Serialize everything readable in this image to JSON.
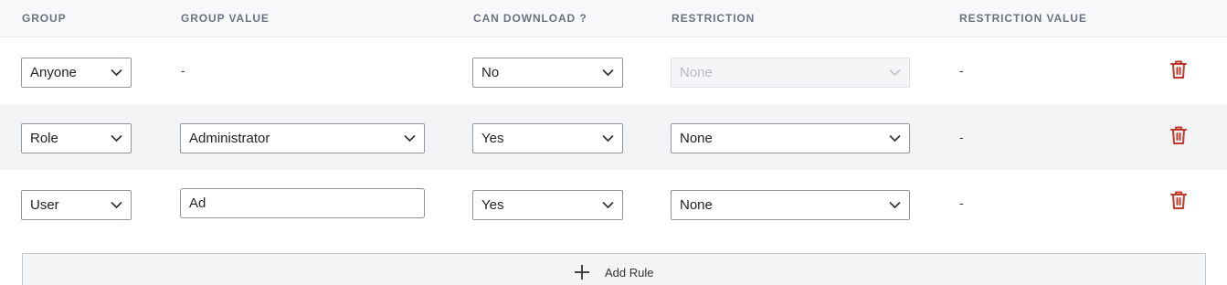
{
  "columns": {
    "group": "GROUP",
    "group_value": "GROUP VALUE",
    "can_download": "CAN DOWNLOAD ?",
    "restriction": "RESTRICTION",
    "restriction_value": "RESTRICTION VALUE"
  },
  "rows": [
    {
      "group": "Anyone",
      "group_value": "-",
      "can_download": "No",
      "restriction": "None",
      "restriction_disabled": true,
      "restriction_value": "-",
      "delete_icon": "trash-icon"
    },
    {
      "group": "Role",
      "group_value": "Administrator",
      "can_download": "Yes",
      "restriction": "None",
      "restriction_disabled": false,
      "restriction_value": "-",
      "delete_icon": "trash-icon"
    },
    {
      "group": "User",
      "group_value": "Ad",
      "can_download": "Yes",
      "restriction": "None",
      "restriction_disabled": false,
      "restriction_value": "-",
      "delete_icon": "trash-icon"
    }
  ],
  "add_rule": {
    "label": "Add Rule",
    "icon": "plus-icon"
  },
  "colors": {
    "danger": "#c0392b",
    "row_shade": "#f2f3f5",
    "header_bg": "#f7f8fa"
  }
}
